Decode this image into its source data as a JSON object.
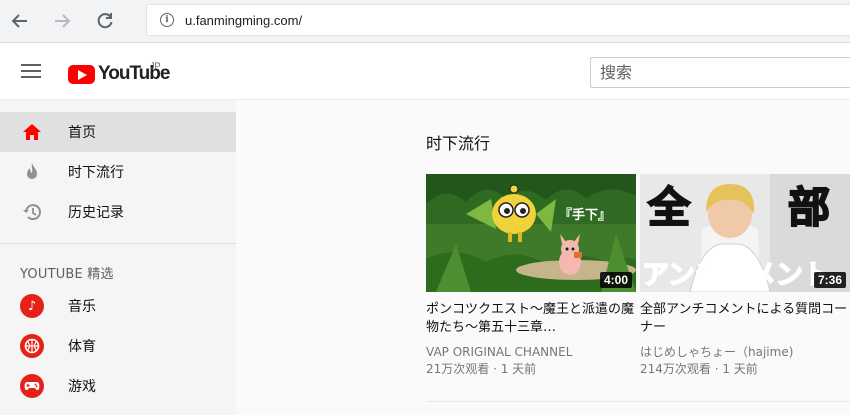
{
  "browser": {
    "url": "u.fanmingming.com/",
    "back_icon": "arrow-left-icon",
    "forward_icon": "arrow-right-icon",
    "reload_icon": "reload-icon",
    "info_icon": "info-icon"
  },
  "masthead": {
    "logo_text": "YouTube",
    "country": "JP",
    "search_placeholder": "搜索",
    "brand_color": "#ff0000"
  },
  "sidebar": {
    "items": [
      {
        "label": "首页",
        "icon": "home-icon",
        "active": true
      },
      {
        "label": "时下流行",
        "icon": "flame-icon",
        "active": false
      },
      {
        "label": "历史记录",
        "icon": "history-icon",
        "active": false
      }
    ],
    "section_title": "YOUTUBE 精选",
    "best_of": [
      {
        "label": "音乐",
        "icon": "music-icon"
      },
      {
        "label": "体育",
        "icon": "sports-icon"
      },
      {
        "label": "游戏",
        "icon": "gaming-icon"
      }
    ]
  },
  "main": {
    "shelf_title": "时下流行",
    "videos": [
      {
        "title": "ポンコツクエスト～魔王と派遣の魔物たち～第五十三章…",
        "channel": "VAP ORIGINAL CHANNEL",
        "views": "21万次观看",
        "age": "1 天前",
        "duration": "4:00",
        "thumb_caption": "『手下』"
      },
      {
        "title": "全部アンチコメントによる質問コーナー",
        "channel": "はじめしゃちょー（hajime)",
        "views": "214万次观看",
        "age": "1 天前",
        "duration": "7:36",
        "thumb_text_top_left": "全",
        "thumb_text_top_right": "部",
        "thumb_text_bottom": "アンチコメント"
      }
    ]
  }
}
